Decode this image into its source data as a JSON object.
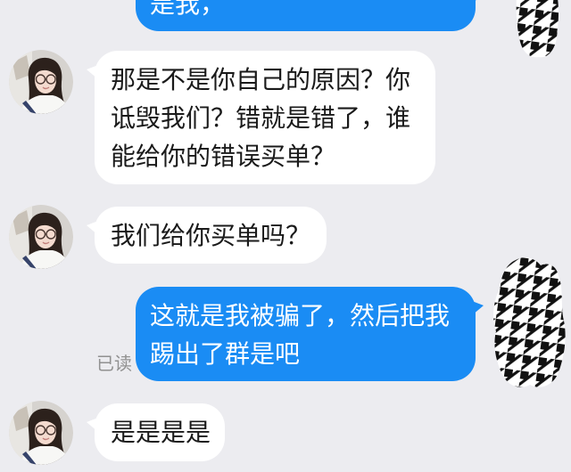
{
  "theme": {
    "background": "#ececf0",
    "outgoing_bubble": "#1a8cf4",
    "outgoing_text": "#ffffff",
    "incoming_bubble": "#ffffff",
    "incoming_text": "#1a1a1a",
    "read_receipt": "#919191"
  },
  "messages": [
    {
      "side": "outgoing",
      "avatar": "houndstooth-avatar",
      "lines": [
        "是我，"
      ]
    },
    {
      "side": "incoming",
      "avatar": "girl-glasses-avatar",
      "lines": [
        "那是不是你自己的原因？你",
        "诋毁我们？错就是错了，谁",
        "能给你的错误买单？"
      ]
    },
    {
      "side": "incoming",
      "avatar": "girl-glasses-avatar",
      "lines": [
        "我们给你买单吗？"
      ]
    },
    {
      "side": "outgoing",
      "avatar": "houndstooth-avatar",
      "lines": [
        "这就是我被骗了，然后把我",
        "踢出了群是吧"
      ],
      "status": "已读"
    },
    {
      "side": "incoming",
      "avatar": "girl-glasses-avatar",
      "lines": [
        "是是是是"
      ]
    }
  ]
}
